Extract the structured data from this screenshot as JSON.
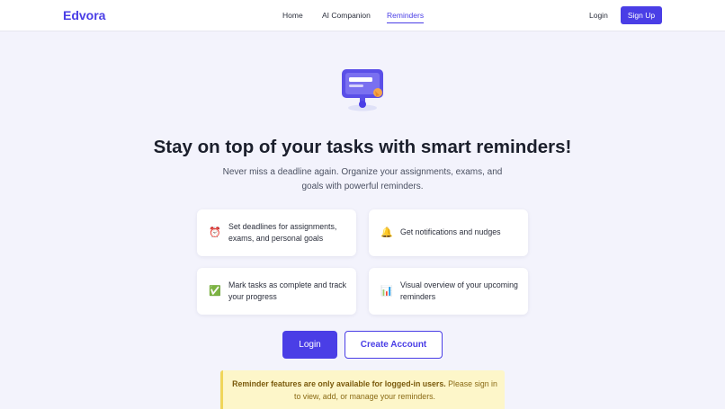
{
  "nav": {
    "brand": "Edvora",
    "links": [
      {
        "label": "Home"
      },
      {
        "label": "AI Companion"
      },
      {
        "label": "Reminders",
        "active": true
      }
    ],
    "login_label": "Login",
    "signup_label": "Sign Up"
  },
  "hero": {
    "icon": "reminder-monitor-icon",
    "headline": "Stay on top of your tasks with smart reminders!",
    "subtitle": "Never miss a deadline again. Organize your assignments, exams, and goals with powerful reminders."
  },
  "features": [
    {
      "icon": "alarm-clock-icon",
      "glyph": "⏰",
      "text": "Set deadlines for assignments, exams, and personal goals"
    },
    {
      "icon": "bell-icon",
      "glyph": "🔔",
      "text": "Get notifications and nudges"
    },
    {
      "icon": "check-mark-icon",
      "glyph": "✅",
      "text": "Mark tasks as complete and track your progress"
    },
    {
      "icon": "bar-chart-icon",
      "glyph": "📊",
      "text": "Visual overview of your upcoming reminders"
    }
  ],
  "actions": {
    "login_label": "Login",
    "create_label": "Create Account"
  },
  "notice": {
    "bold": "Reminder features are only available for logged-in users.",
    "rest": " Please sign in to view, add, or manage your reminders."
  },
  "colors": {
    "accent": "#4a3ee6",
    "background": "#f3f3fc",
    "notice_bg": "#fdf6c9",
    "notice_border": "#f0d65a"
  }
}
